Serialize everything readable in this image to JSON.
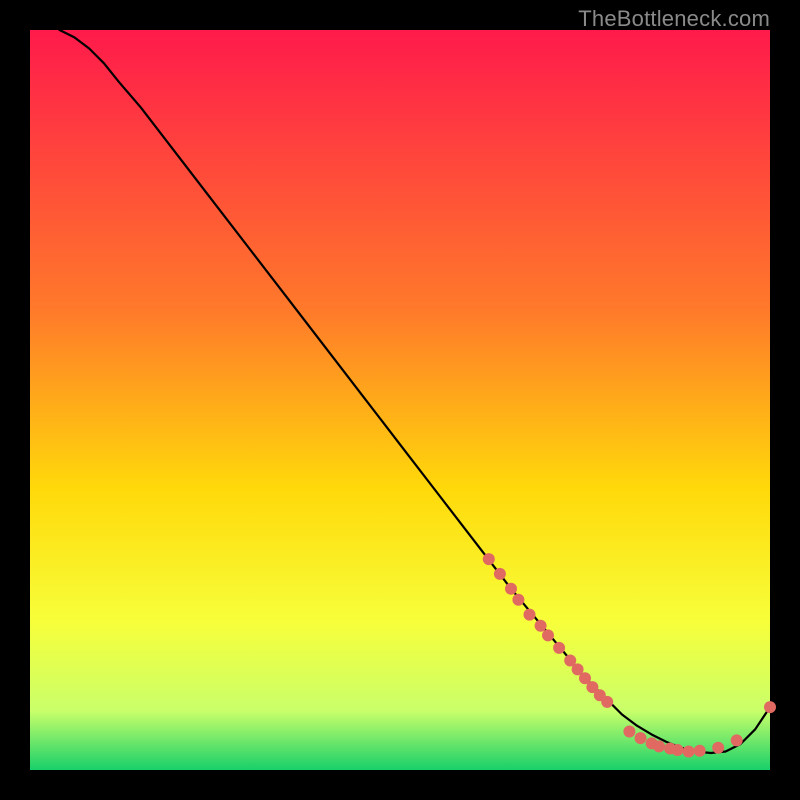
{
  "credit": "TheBottleneck.com",
  "colors": {
    "top": "#ff1a4b",
    "mid1": "#ff7a2a",
    "mid2": "#ffd90a",
    "mid3": "#f7ff3a",
    "mid4": "#c9ff6a",
    "bottom": "#17d06a",
    "curve": "#000000",
    "marker": "#e06a62"
  },
  "chart_data": {
    "type": "line",
    "title": "",
    "xlabel": "",
    "ylabel": "",
    "xlim": [
      0,
      100
    ],
    "ylim": [
      0,
      100
    ],
    "series": [
      {
        "name": "curve",
        "x": [
          4,
          6,
          8,
          10,
          12,
          15,
          20,
          25,
          30,
          35,
          40,
          45,
          50,
          55,
          60,
          65,
          70,
          75,
          78,
          80,
          82,
          84,
          86,
          88,
          90,
          92,
          94,
          96,
          98,
          100
        ],
        "y": [
          100,
          99,
          97.5,
          95.5,
          93,
          89.5,
          83,
          76.5,
          70,
          63.5,
          57,
          50.5,
          44,
          37.5,
          31,
          24.5,
          18.5,
          12.5,
          9.5,
          7.5,
          6,
          4.8,
          3.8,
          3.0,
          2.5,
          2.3,
          2.5,
          3.5,
          5.5,
          8.5
        ]
      }
    ],
    "markers": [
      {
        "x": 62.0,
        "y": 28.5
      },
      {
        "x": 63.5,
        "y": 26.5
      },
      {
        "x": 65.0,
        "y": 24.5
      },
      {
        "x": 66.0,
        "y": 23.0
      },
      {
        "x": 67.5,
        "y": 21.0
      },
      {
        "x": 69.0,
        "y": 19.5
      },
      {
        "x": 70.0,
        "y": 18.2
      },
      {
        "x": 71.5,
        "y": 16.5
      },
      {
        "x": 73.0,
        "y": 14.8
      },
      {
        "x": 74.0,
        "y": 13.6
      },
      {
        "x": 75.0,
        "y": 12.4
      },
      {
        "x": 76.0,
        "y": 11.2
      },
      {
        "x": 77.0,
        "y": 10.1
      },
      {
        "x": 78.0,
        "y": 9.2
      },
      {
        "x": 81.0,
        "y": 5.2
      },
      {
        "x": 82.5,
        "y": 4.3
      },
      {
        "x": 84.0,
        "y": 3.6
      },
      {
        "x": 85.0,
        "y": 3.2
      },
      {
        "x": 86.5,
        "y": 2.9
      },
      {
        "x": 87.5,
        "y": 2.7
      },
      {
        "x": 89.0,
        "y": 2.5
      },
      {
        "x": 90.5,
        "y": 2.6
      },
      {
        "x": 93.0,
        "y": 3.0
      },
      {
        "x": 95.5,
        "y": 4.0
      },
      {
        "x": 100.0,
        "y": 8.5
      }
    ]
  }
}
